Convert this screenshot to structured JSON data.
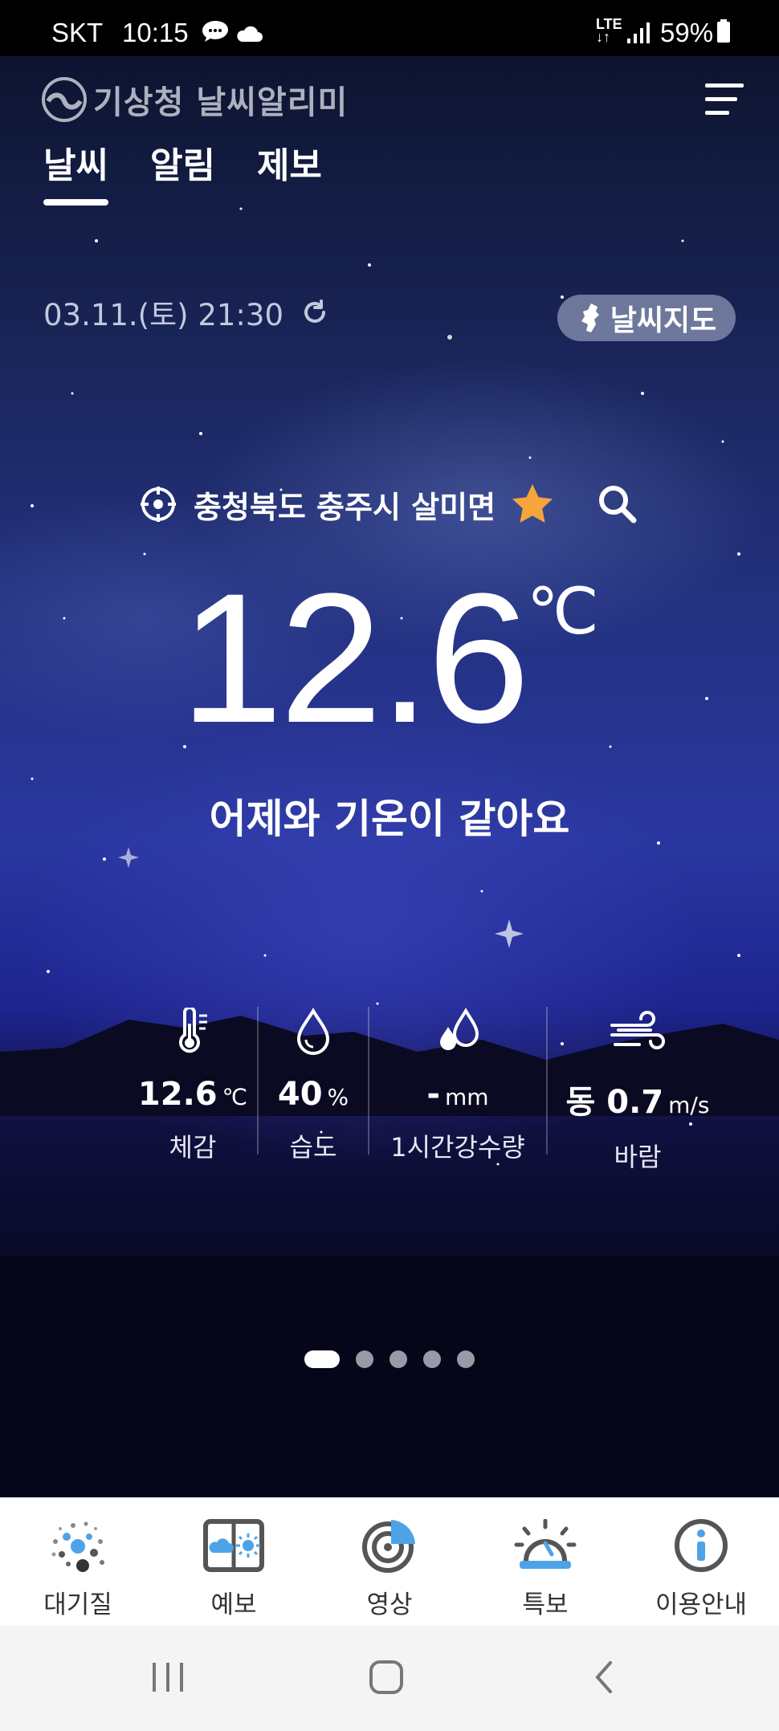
{
  "status_bar": {
    "carrier": "SKT",
    "time": "10:15",
    "network": "LTE",
    "battery": "59%"
  },
  "header": {
    "logo_text": "기상청 날씨알리미",
    "tabs": [
      {
        "label": "날씨",
        "active": true
      },
      {
        "label": "알림",
        "active": false
      },
      {
        "label": "제보",
        "active": false
      }
    ]
  },
  "weather": {
    "datetime": "03.11.(토) 21:30",
    "map_button": "날씨지도",
    "location": "충청북도 충주시 살미면",
    "temperature": "12.6",
    "temp_unit": "℃",
    "comparison": "어제와 기온이 같아요",
    "metrics": {
      "feels_like": {
        "value": "12.6",
        "unit": "℃",
        "label": "체감"
      },
      "humidity": {
        "value": "40",
        "unit": "%",
        "label": "습도"
      },
      "precipitation": {
        "value": "-",
        "unit": "mm",
        "label": "1시간강수량"
      },
      "wind": {
        "value": "동 0.7",
        "unit": "m/s",
        "label": "바람"
      }
    }
  },
  "pager": {
    "total": 5,
    "active": 0
  },
  "bottom_nav": [
    {
      "label": "대기질",
      "icon": "air-quality-icon"
    },
    {
      "label": "예보",
      "icon": "forecast-icon"
    },
    {
      "label": "영상",
      "icon": "radar-icon"
    },
    {
      "label": "특보",
      "icon": "siren-icon"
    },
    {
      "label": "이용안내",
      "icon": "info-icon"
    }
  ],
  "colors": {
    "accent_star": "#f5a53a",
    "nav_blue": "#4ea3e8",
    "nav_gray": "#555555"
  }
}
